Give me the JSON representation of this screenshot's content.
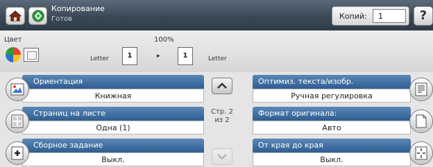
{
  "header": {
    "app_title": "Копирование",
    "status": "Готов",
    "copies_label": "Копий:",
    "copies_value": "1",
    "help_label": "?",
    "icons": {
      "home": "home-icon",
      "app": "copy-icon",
      "help": "help-icon"
    }
  },
  "status_bar": {
    "color_label": "Цвет",
    "zoom": "100%",
    "paper_in": "Letter",
    "tray_in": "1",
    "tray_out": "1",
    "arrow": "▸",
    "paper_out": "Letter"
  },
  "options_left": [
    {
      "title": "Ориентация",
      "value": "Книжная",
      "icon": "orientation-icon"
    },
    {
      "title": "Страниц на листе",
      "value": "Одна (1)",
      "icon": "pages-per-sheet-icon"
    },
    {
      "title": "Сборное задание",
      "value": "Выкл.",
      "icon": "job-build-icon"
    }
  ],
  "options_right": [
    {
      "title": "Оптимиз. текста/изобр.",
      "value": "Ручная регулировка",
      "icon": "optimize-icon"
    },
    {
      "title": "Формат оригинала:",
      "value": "Авто",
      "icon": "original-size-icon"
    },
    {
      "title": "От края до края",
      "value": "Выкл.",
      "icon": "edge-to-edge-icon"
    }
  ],
  "pager": {
    "line1": "Стр. 2",
    "line2": "из 2"
  },
  "colors": {
    "accent_blue": "#2f5d90",
    "header_dark": "#3b4957"
  }
}
